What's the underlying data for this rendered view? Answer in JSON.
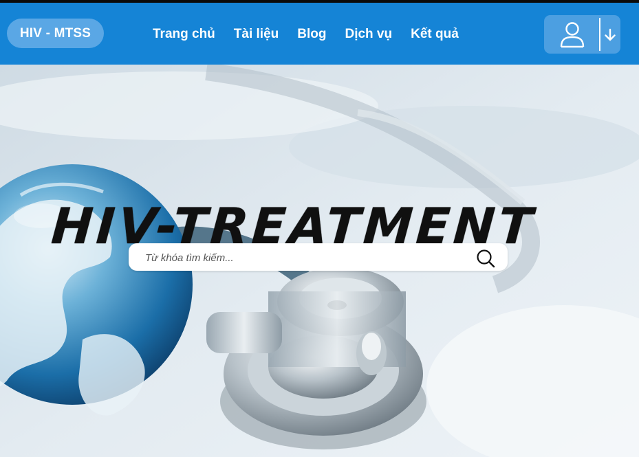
{
  "brand": {
    "logo_text": "HIV - MTSS"
  },
  "nav": {
    "items": [
      {
        "label": "Trang chủ"
      },
      {
        "label": "Tài liệu"
      },
      {
        "label": "Blog"
      },
      {
        "label": "Dịch vụ"
      },
      {
        "label": "Kết quả"
      }
    ]
  },
  "user_menu": {
    "user_icon": "user-icon",
    "dropdown_icon": "arrow-down-icon"
  },
  "hero": {
    "title": "HIV-TREATMENT",
    "search": {
      "placeholder": "Từ khóa tìm kiếm...",
      "value": "",
      "icon": "search-icon"
    },
    "background": "globe-and-stethoscope-photo"
  },
  "colors": {
    "navbar": "#1584d6",
    "logo_pill": "#5aa7e5",
    "user_box": "#4c9fe1"
  }
}
